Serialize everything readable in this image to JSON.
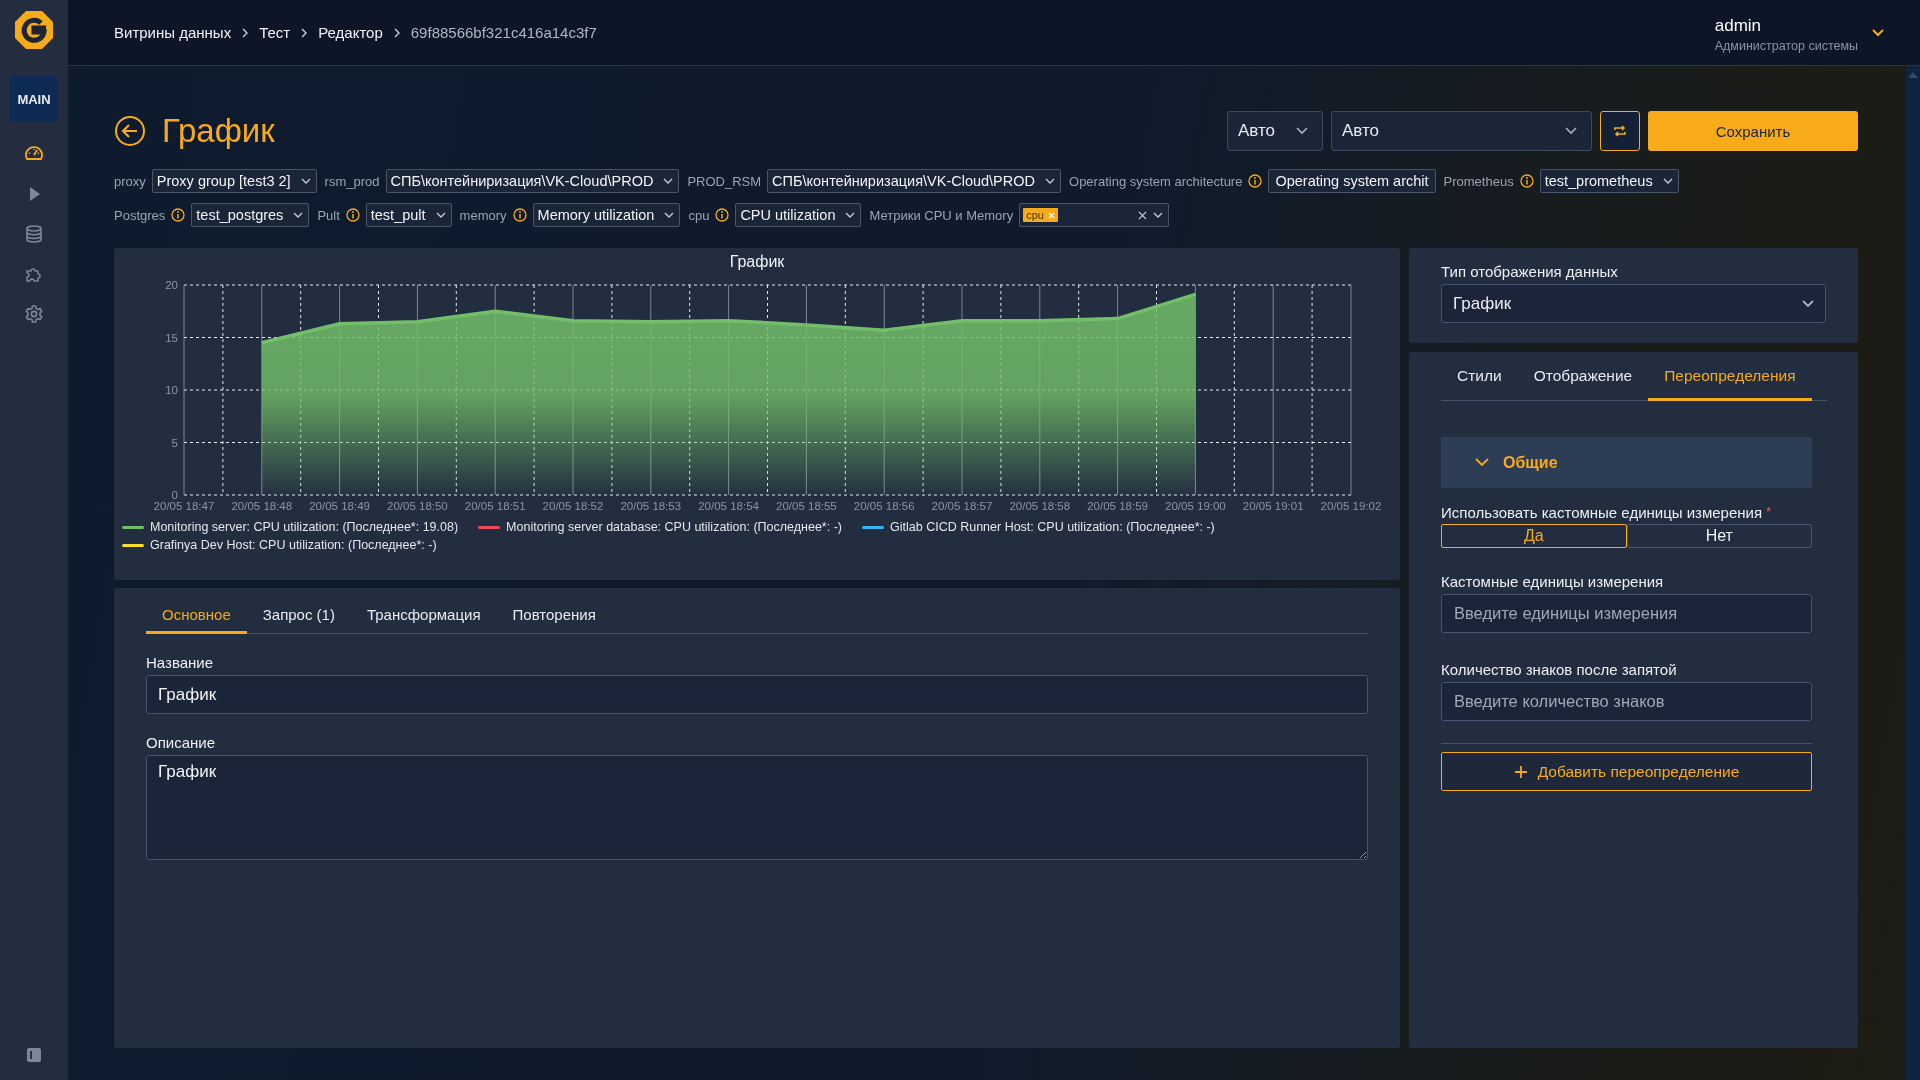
{
  "sidebar": {
    "workspace": "MAIN",
    "items": [
      {
        "selected": true
      },
      {
        "selected": false
      },
      {
        "selected": false
      },
      {
        "selected": false
      },
      {
        "selected": false
      }
    ]
  },
  "header": {
    "breadcrumbs": [
      "Витрины данных",
      "Тест",
      "Редактор",
      "69f88566bf321c416a14c3f7"
    ],
    "user": {
      "name": "admin",
      "role": "Администратор системы"
    }
  },
  "page": {
    "title": "График",
    "selects": [
      "Авто",
      "Авто"
    ],
    "save_button": "Сохранить"
  },
  "filter_rows": [
    {
      "items": [
        {
          "label": "proxy",
          "info": false,
          "kind": "select",
          "value": "Proxy group [test3 2]"
        },
        {
          "label": "rsm_prod",
          "info": false,
          "kind": "select",
          "value": "СПБ\\контейниризация\\VK-Cloud\\PROD"
        },
        {
          "label": "PROD_RSM",
          "info": false,
          "kind": "select",
          "value": "СПБ\\контейниризация\\VK-Cloud\\PROD"
        },
        {
          "label": "Operating system architecture",
          "info": true,
          "kind": "text",
          "value": "Operating system archit"
        },
        {
          "label": "Prometheus",
          "info": true,
          "kind": "select",
          "value": "test_prometheus"
        }
      ]
    },
    {
      "items": [
        {
          "label": "Postgres",
          "info": true,
          "kind": "select",
          "value": "test_postgres"
        },
        {
          "label": "Pult",
          "info": true,
          "kind": "select",
          "value": "test_pult"
        },
        {
          "label": "memory",
          "info": true,
          "kind": "select",
          "value": "Memory utilization"
        },
        {
          "label": "cpu",
          "info": true,
          "kind": "select",
          "value": "CPU utilization"
        },
        {
          "label": "Метрики CPU и Memory",
          "info": false,
          "kind": "multiselect",
          "tags": [
            "cpu"
          ]
        }
      ]
    }
  ],
  "chart_panel": {
    "chart_data": {
      "type": "area",
      "title": "График",
      "categories": [
        "20/05 18:47",
        "20/05 18:48",
        "20/05 18:49",
        "20/05 18:50",
        "20/05 18:51",
        "20/05 18:52",
        "20/05 18:53",
        "20/05 18:54",
        "20/05 18:55",
        "20/05 18:56",
        "20/05 18:57",
        "20/05 18:58",
        "20/05 18:59",
        "20/05 19:00",
        "20/05 19:01",
        "20/05 19:02"
      ],
      "ylim": [
        0,
        20
      ],
      "grid": true,
      "yticks": [
        0,
        5,
        10,
        15,
        20
      ],
      "series": [
        {
          "name": "Monitoring server: CPU utilization: (Последнее*: 19.08)",
          "color": "#73bf69",
          "values": [
            null,
            14.5,
            16.3,
            16.5,
            17.5,
            16.6,
            16.5,
            16.6,
            16.2,
            15.7,
            16.6,
            16.6,
            16.8,
            19.1,
            null,
            null
          ]
        },
        {
          "name": "Monitoring server database: CPU utilization: (Последнее*: -)",
          "color": "#f2495c",
          "values": [
            null,
            null,
            null,
            null,
            null,
            null,
            null,
            null,
            null,
            null,
            null,
            null,
            null,
            null,
            null,
            null
          ]
        },
        {
          "name": "Gitlab CICD Runner Host: CPU utilization: (Последнее*: -)",
          "color": "#33b5f0",
          "values": [
            null,
            null,
            null,
            null,
            null,
            null,
            null,
            null,
            null,
            null,
            null,
            null,
            null,
            null,
            null,
            null
          ]
        },
        {
          "name": "Grafinya Dev Host: CPU utilization: (Последнее*: -)",
          "color": "#fade2a",
          "values": [
            null,
            null,
            null,
            null,
            null,
            null,
            null,
            null,
            null,
            null,
            null,
            null,
            null,
            null,
            null,
            null
          ]
        }
      ]
    }
  },
  "editor": {
    "tabs": [
      {
        "label": "Основное",
        "selected": true
      },
      {
        "label": "Запрос (1)",
        "selected": false
      },
      {
        "label": "Трансформация",
        "selected": false
      },
      {
        "label": "Повторения",
        "selected": false
      }
    ],
    "fields": [
      {
        "kind": "input",
        "label": "Название",
        "value": "График"
      },
      {
        "kind": "textarea",
        "label": "Описание",
        "value": "График"
      }
    ]
  },
  "display_type": {
    "label": "Тип отображения данных",
    "value": "График"
  },
  "overrides": {
    "tabs": [
      {
        "label": "Стили",
        "selected": false
      },
      {
        "label": "Отображение",
        "selected": false
      },
      {
        "label": "Переопределения",
        "selected": true
      }
    ],
    "section": {
      "title": "Общие",
      "expanded": true
    },
    "unit_toggle": {
      "label": "Использовать кастомные единицы измерения",
      "required_mark": "*",
      "options": [
        {
          "label": "Да",
          "selected": true
        },
        {
          "label": "Нет",
          "selected": false
        }
      ]
    },
    "fields": [
      {
        "label": "Кастомные единицы измерения",
        "placeholder": "Введите единицы измерения"
      },
      {
        "label": "Количество знаков после запятой",
        "placeholder": "Введите количество знаков"
      }
    ],
    "add_button": "Добавить переопределение"
  }
}
